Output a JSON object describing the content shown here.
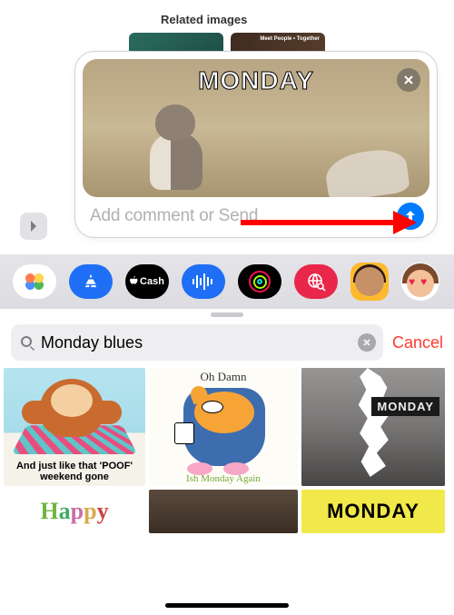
{
  "header": {
    "related_label": "Related images",
    "bg_thumb2_overlay": "Meet People • Together"
  },
  "compose": {
    "preview_caption": "MONDAY",
    "close_icon": "close",
    "placeholder": "Add comment or Send",
    "send_icon": "arrow-up"
  },
  "app_tray": {
    "items": [
      {
        "name": "photos"
      },
      {
        "name": "app-store"
      },
      {
        "name": "apple-cash",
        "label": "Cash"
      },
      {
        "name": "audio"
      },
      {
        "name": "fitness"
      },
      {
        "name": "gif-search"
      },
      {
        "name": "memoji-1"
      },
      {
        "name": "memoji-2"
      }
    ]
  },
  "gif_drawer": {
    "search_query": "Monday blues",
    "cancel_label": "Cancel",
    "results_row1": [
      {
        "caption_top": "",
        "caption_bottom": "And just like that 'POOF' weekend gone"
      },
      {
        "caption_top": "Oh Damn",
        "caption_bottom": "Ish Monday Again"
      },
      {
        "label": "MONDAY"
      }
    ],
    "results_row2": [
      {
        "text": "Happy"
      },
      {
        "text": ""
      },
      {
        "text": "MONDAY"
      }
    ]
  }
}
